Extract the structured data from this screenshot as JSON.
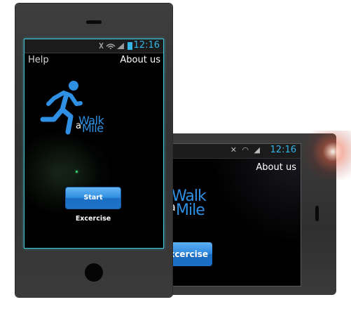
{
  "front_screen": {
    "status_bar": {
      "time": "12:16",
      "icons": [
        "mute-icon",
        "wifi-icon",
        "signal-icon",
        "battery-icon"
      ]
    },
    "menu": {
      "help_label": "Help",
      "about_label": "About us"
    },
    "logo": {
      "word_walk": "Walk",
      "word_a": "a",
      "word_mile": "Mile",
      "icon": "runner-icon"
    },
    "start_button_label": "Start Excercise"
  },
  "back_screen": {
    "status_bar": {
      "time": "12:16"
    },
    "menu": {
      "about_label": "About us"
    },
    "logo": {
      "word_walk": "Walk",
      "word_a": "a",
      "word_mile": "Mile"
    },
    "start_button_label": "xcercise"
  },
  "colors": {
    "accent_blue": "#33b5e5",
    "logo_blue": "#2f8fe2",
    "screen_border": "#3fc3d8",
    "phone_body": "#333333",
    "button_blue": "#2f8ee0"
  }
}
